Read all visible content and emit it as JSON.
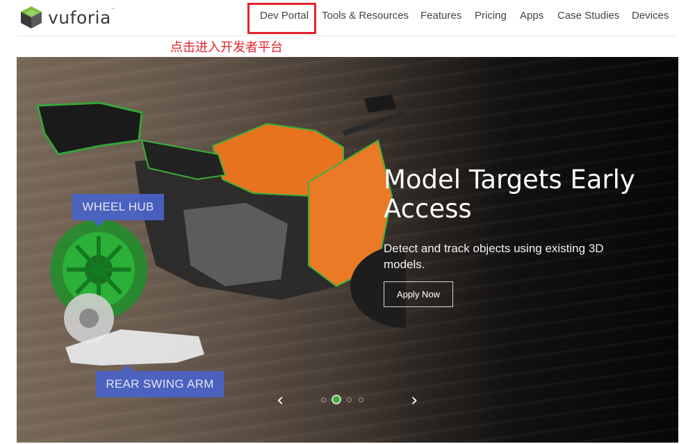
{
  "brand": {
    "name": "vuforia",
    "tm": "™",
    "logo_icon": "vuforia-cube-icon"
  },
  "nav": {
    "items": [
      {
        "label": "Dev Portal"
      },
      {
        "label": "Tools & Resources"
      },
      {
        "label": "Features"
      },
      {
        "label": "Pricing"
      },
      {
        "label": "Apps"
      },
      {
        "label": "Case Studies"
      },
      {
        "label": "Devices"
      }
    ]
  },
  "annotation": {
    "text": "点击进入开发者平台",
    "color": "#e5222a"
  },
  "hero": {
    "title": "Model Targets Early Access",
    "subtitle": "Detect and track objects using existing 3D models.",
    "cta_label": "Apply Now",
    "tags": {
      "wheel": "WHEEL HUB",
      "arm": "REAR SWING ARM"
    },
    "carousel": {
      "prev_icon": "chevron-left-icon",
      "next_icon": "chevron-right-icon",
      "slide_count": 4,
      "active_slide": 2
    }
  },
  "colors": {
    "accent_green": "#3fae3a",
    "tag_blue": "#4a63c9",
    "moto_orange": "#e8731f"
  }
}
